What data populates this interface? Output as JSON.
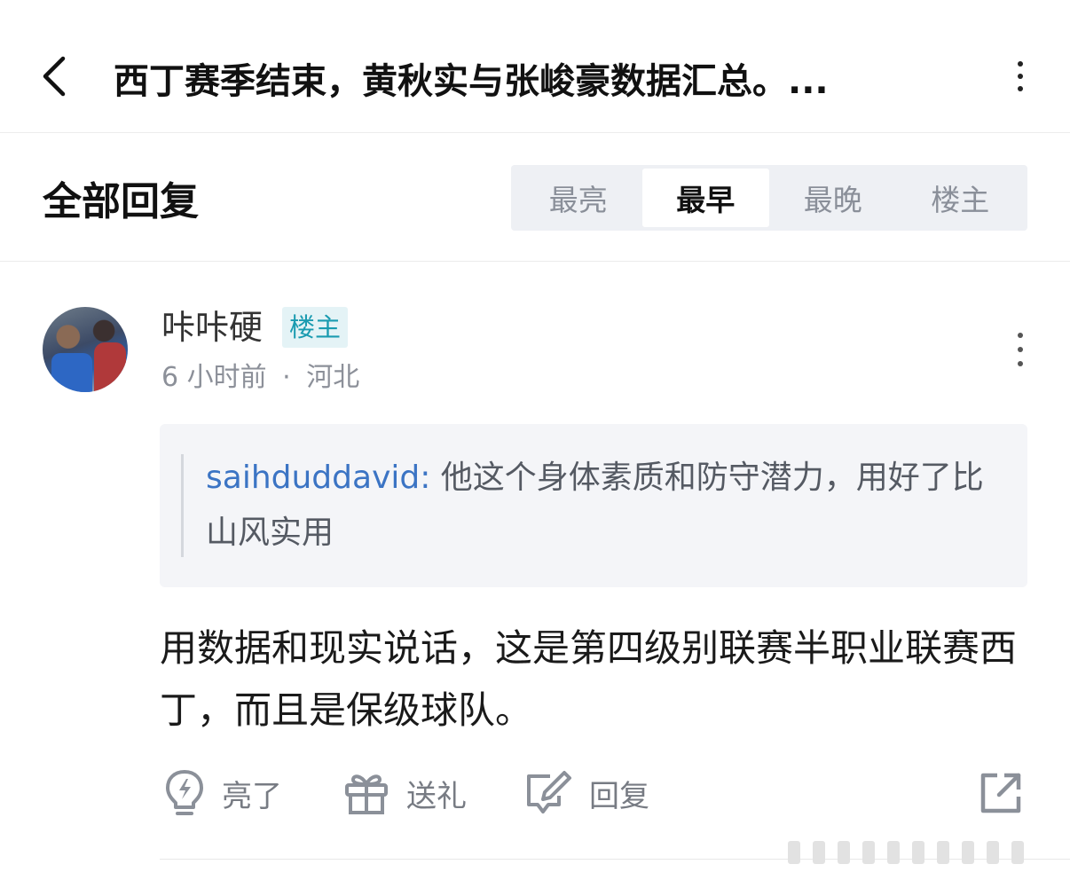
{
  "header": {
    "back_icon": "chevron-left-icon",
    "title": "西丁赛季结束，黄秋实与张峻豪数据汇总。...",
    "more_icon": "more-vertical-icon"
  },
  "replies": {
    "title": "全部回复",
    "sort_tabs": [
      {
        "label": "最亮",
        "active": false
      },
      {
        "label": "最早",
        "active": true
      },
      {
        "label": "最晚",
        "active": false
      },
      {
        "label": "楼主",
        "active": false
      }
    ]
  },
  "comment": {
    "user_name": "咔咔硬",
    "badge": "楼主",
    "time": "6 小时前",
    "separator": "·",
    "location": "河北",
    "quote_user": "saihduddavid:",
    "quote_text": " 他这个身体素质和防守潜力，用好了比山风实用",
    "body": "用数据和现实说话，这是第四级别联赛半职业联赛西丁，而且是保级球队。",
    "actions": {
      "like_label": "亮了",
      "gift_label": "送礼",
      "reply_label": "回复"
    }
  },
  "colors": {
    "badge_bg": "#e4f3f6",
    "badge_text": "#1a9bb0",
    "quote_user": "#3b74c4",
    "tab_bg": "#eef0f4"
  }
}
